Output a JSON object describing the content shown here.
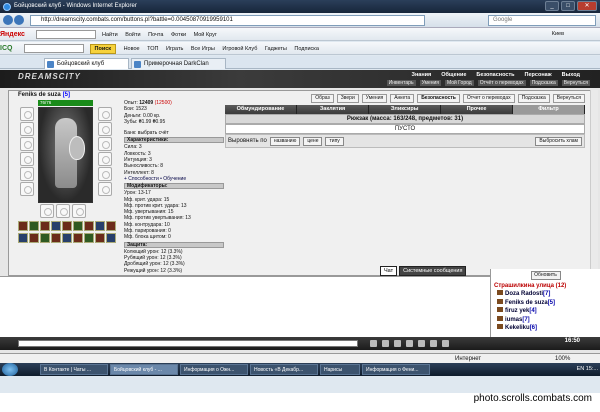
{
  "browser": {
    "title": "Бойцовский клуб - Windows Internet Explorer",
    "url": "http://dreamscity.combats.com/buttons.pl?battle=0.00450870919959101",
    "search_placeholder": "Google"
  },
  "toolbar1": {
    "logo": "Яндекс",
    "find": "Найти",
    "items": [
      "Войти",
      "Почта",
      "Фотки",
      "Мой Круг"
    ],
    "right": "Киев"
  },
  "toolbar2": {
    "logo": "ICQ",
    "search_btn": "Поиск",
    "items": [
      "Новое",
      "ТОП",
      "Играть",
      "Все Игры",
      "Игровой Клуб",
      "Гаджеты",
      "Подписка"
    ]
  },
  "tabs": [
    {
      "label": "Бойцовский клуб"
    },
    {
      "label": "Примерочная DarkClan"
    }
  ],
  "game": {
    "brand": "DREAMSCITY",
    "menu": [
      "Знания",
      "Общение",
      "Безопасность",
      "Персонаж",
      "Выход"
    ],
    "submenu": [
      "Инвентарь",
      "Умения",
      "Мой Город",
      "Отчёт о переводах",
      "Подсказка",
      "Вернуться"
    ],
    "character": {
      "name": "Feniks de suza",
      "level": "[5]",
      "hp": "76/76"
    },
    "stats": {
      "exp_label": "Опыт:",
      "exp": "12409",
      "exp_next": "(12500)",
      "wins_label": "Бои:",
      "wins": "1523",
      "money_label": "Деньги:",
      "money": "0.00 кр.",
      "teeth_label": "Зубы:",
      "teeth": "₴1.99 ₴0.95",
      "bank": "Банк: выбрать счёт",
      "chars_header": "Характеристики:",
      "str": "Сила: 3",
      "agi": "Ловкость: 3",
      "int": "Интуиция: 3",
      "end": "Выносливость: 8",
      "wis": "Интеллект: 8",
      "skills": "+ Способности • Обучение",
      "mods_header": "Модификаторы:",
      "dmg": "Урон: 13-17",
      "mf1": "Мф. крит. удара: 15",
      "mf2": "Мф. против крит. удара: 13",
      "mf3": "Мф. увертывания: 15",
      "mf4": "Мф. против увертывания: 13",
      "mf5": "Мф. контрудара: 10",
      "mf6": "Мф. парирования: 0",
      "mf7": "Мф. блока щитом: 0",
      "def_header": "Защита:",
      "d1": "Колющий урон: 12 (3.3%)",
      "d2": "Рубящий урон: 12 (3.3%)",
      "d3": "Дробящий урон: 12 (3.3%)",
      "d4": "Режущий урон: 12 (3.3%)"
    },
    "inventory": {
      "top_buttons": [
        "Образ",
        "Звери",
        "Умения",
        "Анкета",
        "Безопасность",
        "Отчет о переводах",
        "Подсказка",
        "Вернуться"
      ],
      "categories": [
        "Обмундирование",
        "Заклятия",
        "Эликсиры",
        "Прочее",
        "Фильтр"
      ],
      "rucksack": "Рюкзак (масса: 163/248, предметов: 31)",
      "empty": "ПУСТО",
      "sort_label": "Выровнять по",
      "sort_options": [
        "названию",
        "цене",
        "типу"
      ],
      "select_clan": "Выбросить хлам"
    },
    "chat_tabs": [
      "Чат",
      "Системные сообщения"
    ],
    "people": {
      "update": "Обновить",
      "room": "Страшилкина улица (12)",
      "list": [
        {
          "name": "Doza Radosti",
          "level": "[7]"
        },
        {
          "name": "Feniks de suza",
          "level": "[5]"
        },
        {
          "name": "firuz yek",
          "level": "[4]"
        },
        {
          "name": "iumas",
          "level": "[7]"
        },
        {
          "name": "Kekeliku",
          "level": "[6]"
        }
      ]
    },
    "clock": "16:50"
  },
  "statusbar": {
    "zone": "Интернет",
    "zoom": "100%"
  },
  "taskbar": {
    "items": [
      "В Контакте | Чаты ...",
      "Бойцовский клуб - ...",
      "Информация о Ожн...",
      "Новость «В Декабр...",
      "Нарисы",
      "Информация о Фени..."
    ],
    "lang": "EN",
    "time": "15:..."
  },
  "watermark": "photo.scrolls.combats.com"
}
